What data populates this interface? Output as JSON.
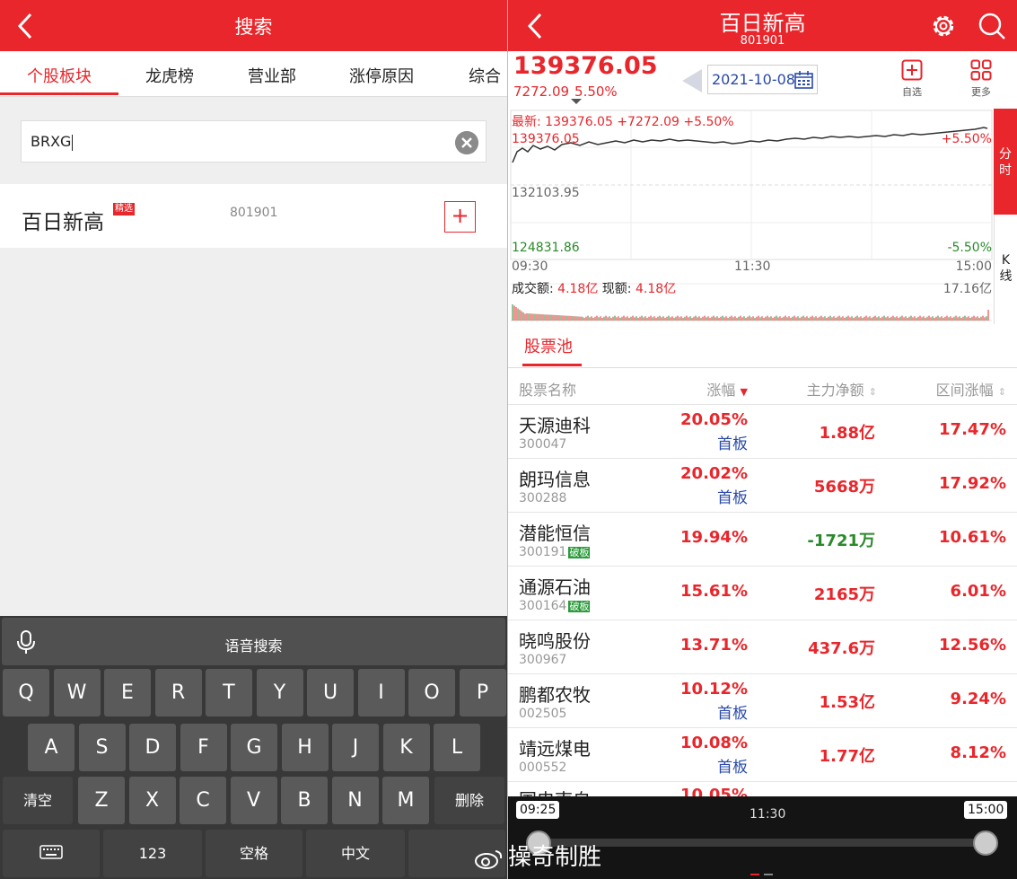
{
  "left": {
    "header": {
      "title": "搜索"
    },
    "tabs": [
      "个股板块",
      "龙虎榜",
      "营业部",
      "涨停原因",
      "综合"
    ],
    "search": {
      "value": "BRXG"
    },
    "result": {
      "name": "百日新高",
      "badge": "精选",
      "code": "801901",
      "add_label": "+"
    },
    "keyboard": {
      "voice_label": "语音搜索",
      "row1": [
        "Q",
        "W",
        "E",
        "R",
        "T",
        "Y",
        "U",
        "I",
        "O",
        "P"
      ],
      "row2": [
        "A",
        "S",
        "D",
        "F",
        "G",
        "H",
        "J",
        "K",
        "L"
      ],
      "row3_left": "清空",
      "row3": [
        "Z",
        "X",
        "C",
        "V",
        "B",
        "N",
        "M"
      ],
      "row3_right": "删除",
      "num_label": "123",
      "space_label": "空格",
      "lang_label": "中文"
    }
  },
  "right": {
    "header": {
      "title": "百日新高",
      "code": "801901"
    },
    "quote": {
      "price": "139376.05",
      "change": "7272.09",
      "change_pct": "5.50%"
    },
    "date": "2021-10-08",
    "actions": {
      "watch": "自选",
      "more": "更多"
    },
    "chart": {
      "latest_line": "最新: 139376.05 +7272.09 +5.50%",
      "y_top": "139376.05",
      "y_mid": "132103.95",
      "y_bot": "124831.86",
      "pct_top": "+5.50%",
      "pct_bot": "-5.50%",
      "t_start": "09:30",
      "t_mid": "11:30",
      "t_end": "15:00",
      "volume_label": "成交额:",
      "volume_value": "4.18亿",
      "current_label": "现额:",
      "current_value": "4.18亿",
      "vol_max": "17.16亿",
      "tab_fenshi": "分时",
      "tab_kline": "K线"
    },
    "pool": {
      "tab": "股票池"
    },
    "table": {
      "headers": [
        "股票名称",
        "涨幅",
        "主力净额",
        "区间涨幅"
      ],
      "rows": [
        {
          "name": "天源迪科",
          "code": "300047",
          "pct": "20.05%",
          "tag": "首板",
          "broken": "",
          "net": "1.88亿",
          "range": "17.47%"
        },
        {
          "name": "朗玛信息",
          "code": "300288",
          "pct": "20.02%",
          "tag": "首板",
          "broken": "",
          "net": "5668万",
          "range": "17.92%"
        },
        {
          "name": "潜能恒信",
          "code": "300191",
          "pct": "19.94%",
          "tag": "",
          "broken": "破板",
          "net": "-1721万",
          "range": "10.61%"
        },
        {
          "name": "通源石油",
          "code": "300164",
          "pct": "15.61%",
          "tag": "",
          "broken": "破板",
          "net": "2165万",
          "range": "6.01%"
        },
        {
          "name": "晓鸣股份",
          "code": "300967",
          "pct": "13.71%",
          "tag": "",
          "broken": "",
          "net": "437.6万",
          "range": "12.56%"
        },
        {
          "name": "鹏都农牧",
          "code": "002505",
          "pct": "10.12%",
          "tag": "首板",
          "broken": "",
          "net": "1.53亿",
          "range": "9.24%"
        },
        {
          "name": "靖远煤电",
          "code": "000552",
          "pct": "10.08%",
          "tag": "首板",
          "broken": "",
          "net": "1.77亿",
          "range": "8.12%"
        }
      ]
    },
    "timeline": {
      "start": "09:25",
      "mid": "11:30",
      "end": "15:00"
    }
  },
  "watermark": "操奇制胜",
  "colors": {
    "accent": "#e8262b",
    "up": "#e8262b",
    "down": "#2a8a2a",
    "link": "#2a4aa8"
  }
}
